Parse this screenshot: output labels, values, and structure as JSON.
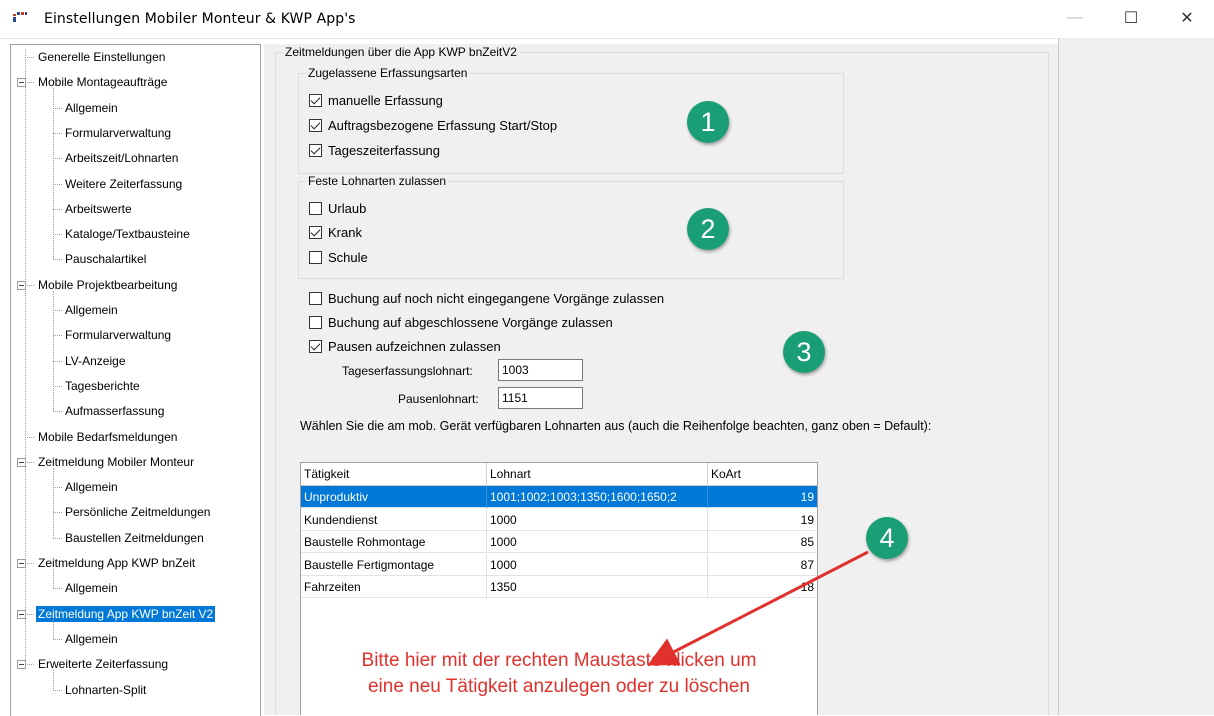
{
  "window": {
    "title": "Einstellungen Mobiler Monteur & KWP App's",
    "minimize": "—",
    "maximize": "☐",
    "close": "✕"
  },
  "tree": {
    "items": [
      {
        "label": "Generelle Einstellungen",
        "level": 0
      },
      {
        "label": "Mobile Montageaufträge",
        "level": 0,
        "expandable": true
      },
      {
        "label": "Allgemein",
        "level": 1
      },
      {
        "label": "Formularverwaltung",
        "level": 1
      },
      {
        "label": "Arbeitszeit/Lohnarten",
        "level": 1
      },
      {
        "label": "Weitere Zeiterfassung",
        "level": 1
      },
      {
        "label": "Arbeitswerte",
        "level": 1
      },
      {
        "label": "Kataloge/Textbausteine",
        "level": 1
      },
      {
        "label": "Pauschalartikel",
        "level": 1
      },
      {
        "label": "Mobile Projektbearbeitung",
        "level": 0,
        "expandable": true
      },
      {
        "label": "Allgemein",
        "level": 1
      },
      {
        "label": "Formularverwaltung",
        "level": 1
      },
      {
        "label": "LV-Anzeige",
        "level": 1
      },
      {
        "label": "Tagesberichte",
        "level": 1
      },
      {
        "label": "Aufmasserfassung",
        "level": 1
      },
      {
        "label": "Mobile Bedarfsmeldungen",
        "level": 0
      },
      {
        "label": "Zeitmeldung Mobiler Monteur",
        "level": 0,
        "expandable": true
      },
      {
        "label": "Allgemein",
        "level": 1
      },
      {
        "label": "Persönliche Zeitmeldungen",
        "level": 1
      },
      {
        "label": "Baustellen Zeitmeldungen",
        "level": 1
      },
      {
        "label": "Zeitmeldung App KWP bnZeit",
        "level": 0,
        "expandable": true
      },
      {
        "label": "Allgemein",
        "level": 1
      },
      {
        "label": "Zeitmeldung App KWP bnZeit V2",
        "level": 0,
        "expandable": true,
        "selected": true
      },
      {
        "label": "Allgemein",
        "level": 1
      },
      {
        "label": "Erweiterte Zeiterfassung",
        "level": 0,
        "expandable": true
      },
      {
        "label": "Lohnarten-Split",
        "level": 1
      }
    ]
  },
  "main": {
    "section_title": "Zeitmeldungen über die App KWP bnZeitV2",
    "group1": {
      "title": "Zugelassene Erfassungsarten",
      "options": [
        {
          "label": "manuelle Erfassung",
          "checked": true
        },
        {
          "label": "Auftragsbezogene Erfassung Start/Stop",
          "checked": true
        },
        {
          "label": "Tageszeiterfassung",
          "checked": true
        }
      ]
    },
    "group2": {
      "title": "Feste Lohnarten zulassen",
      "options": [
        {
          "label": "Urlaub",
          "checked": false
        },
        {
          "label": "Krank",
          "checked": true
        },
        {
          "label": "Schule",
          "checked": false
        }
      ]
    },
    "options": [
      {
        "label": "Buchung auf noch nicht eingegangene Vorgänge zulassen",
        "checked": false
      },
      {
        "label": "Buchung auf abgeschlossene Vorgänge zulassen",
        "checked": false
      },
      {
        "label": "Pausen aufzeichnen zulassen",
        "checked": true
      }
    ],
    "tageserfassung_label": "Tageserfassungslohnart:",
    "tageserfassung_value": "1003",
    "pausen_label": "Pausenlohnart:",
    "pausen_value": "1151",
    "instruction": "Wählen Sie die am mob. Gerät verfügbaren Lohnarten aus (auch die Reihenfolge beachten, ganz oben = Default):",
    "grid": {
      "columns": [
        "Tätigkeit",
        "Lohnart",
        "KoArt"
      ],
      "rows": [
        {
          "taetigkeit": "Unproduktiv",
          "lohnart": "1001;1002;1003;1350;1600;1650;2",
          "koart": "19",
          "selected": true
        },
        {
          "taetigkeit": "Kundendienst",
          "lohnart": "1000",
          "koart": "19"
        },
        {
          "taetigkeit": "Baustelle Rohmontage",
          "lohnart": "1000",
          "koart": "85"
        },
        {
          "taetigkeit": "Baustelle Fertigmontage",
          "lohnart": "1000",
          "koart": "87"
        },
        {
          "taetigkeit": "Fahrzeiten",
          "lohnart": "1350",
          "koart": "18"
        }
      ]
    },
    "badges": [
      "1",
      "2",
      "3",
      "4"
    ],
    "annotation_line1": "Bitte hier mit der rechten Maustaste klicken um",
    "annotation_line2": "eine neu Tätigkeit anzulegen oder zu löschen",
    "colors": {
      "badge": "#1a9e76",
      "annotation": "#e0312c",
      "selection": "#0078d7"
    }
  }
}
